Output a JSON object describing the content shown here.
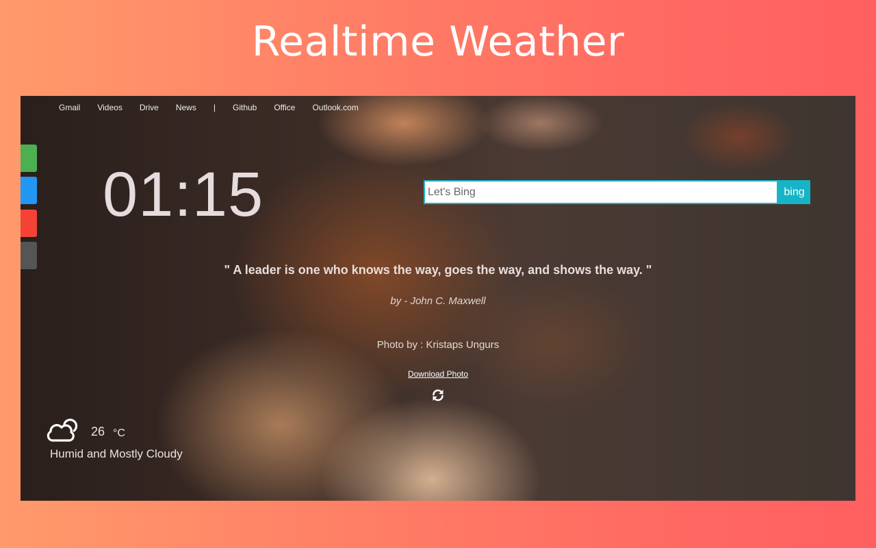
{
  "promo": {
    "title": "Realtime Weather"
  },
  "nav": {
    "items": [
      "Gmail",
      "Videos",
      "Drive",
      "News",
      "|",
      "Github",
      "Office",
      "Outlook.com"
    ]
  },
  "side_tabs": {
    "colors": [
      "#4caf50",
      "#2196f3",
      "#f44336",
      "#555555"
    ]
  },
  "clock": {
    "time": "01:15"
  },
  "search": {
    "placeholder": "Let's Bing",
    "value": "",
    "button_label": "bing"
  },
  "quote": {
    "text": "\" A leader is one who knows the way, goes the way, and shows the way. \"",
    "author": "by - John C. Maxwell"
  },
  "photo": {
    "credit": "Photo by : Kristaps Ungurs",
    "download_label": "Download Photo",
    "refresh_icon": "refresh-icon"
  },
  "weather": {
    "icon": "partly-cloudy-icon",
    "temperature": "26",
    "unit": "°C",
    "condition": "Humid and Mostly Cloudy"
  }
}
